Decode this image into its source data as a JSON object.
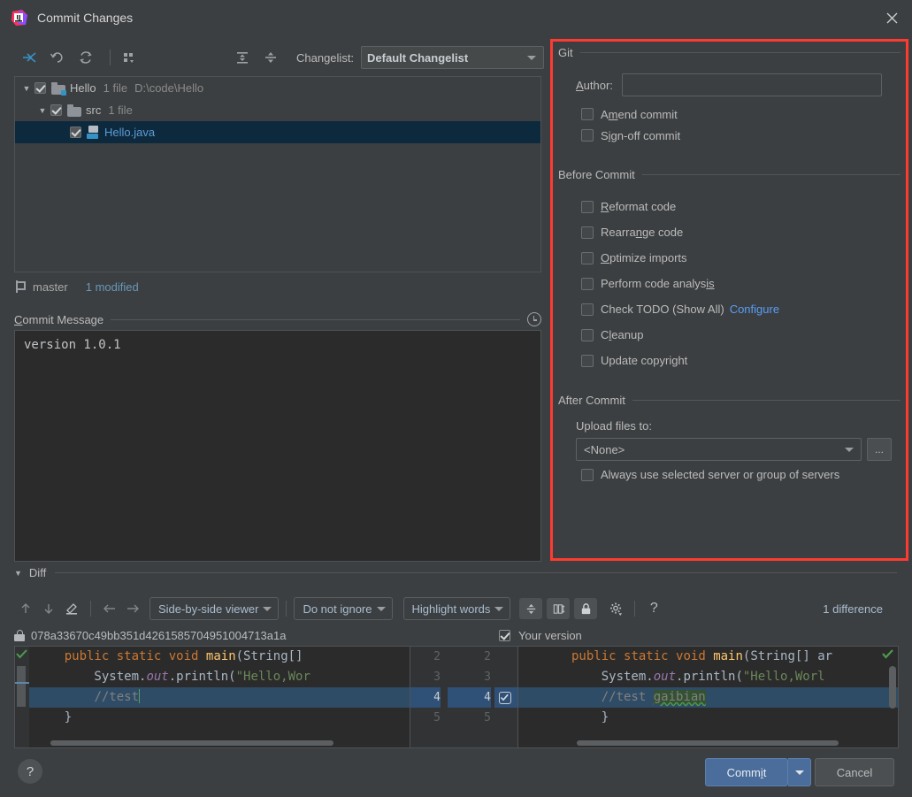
{
  "window": {
    "title": "Commit Changes",
    "logo_icon": "intellij-idea-logo",
    "close_icon": "close-icon"
  },
  "toolbar": {
    "icons": [
      {
        "name": "show-diff-icon",
        "glyph": "arrow-collapse"
      },
      {
        "name": "revert-icon",
        "glyph": "undo"
      },
      {
        "name": "refresh-icon",
        "glyph": "refresh"
      },
      {
        "name": "group-by-icon",
        "glyph": "group"
      },
      {
        "name": "expand-all-icon",
        "glyph": "expand"
      },
      {
        "name": "collapse-all-icon",
        "glyph": "collapse"
      }
    ],
    "changelist_label": "Changelist:",
    "changelist_value": "Default Changelist"
  },
  "tree": {
    "nodes": [
      {
        "name": "Hello",
        "meta": "1 file",
        "path": "D:\\code\\Hello",
        "checked": true,
        "depth": 0,
        "expanded": true,
        "type": "module"
      },
      {
        "name": "src",
        "meta": "1 file",
        "path": "",
        "checked": true,
        "depth": 1,
        "expanded": true,
        "type": "folder"
      },
      {
        "name": "Hello.java",
        "meta": "",
        "path": "",
        "checked": true,
        "depth": 2,
        "expanded": null,
        "type": "java",
        "selected": true
      }
    ]
  },
  "branch": {
    "icon": "git-branch-icon",
    "name": "master",
    "modified": "1 modified"
  },
  "commit_message": {
    "section_title": "Commit Message",
    "section_mnemonic": "C",
    "history_icon": "clock-history-icon",
    "value": "version 1.0.1"
  },
  "options": {
    "git": {
      "title": "Git",
      "author_label": "Author:",
      "author_mnemonic": "A",
      "author_value": "",
      "checkboxes": [
        {
          "label_before": "A",
          "mnemonic": "m",
          "label_after": "end commit",
          "full": "Amend commit",
          "checked": false,
          "name": "amend-commit"
        },
        {
          "label_before": "S",
          "mnemonic": "ig",
          "label_after": "n-off commit",
          "full": "Sign-off commit",
          "checked": false,
          "name": "sign-off-commit"
        }
      ]
    },
    "before_commit": {
      "title": "Before Commit",
      "checkboxes": [
        {
          "label_before": "",
          "mnemonic": "R",
          "label_after": "eformat code",
          "full": "Reformat code",
          "checked": false,
          "name": "reformat-code"
        },
        {
          "label_before": "Rearra",
          "mnemonic": "n",
          "label_after": "ge code",
          "full": "Rearrange code",
          "checked": false,
          "name": "rearrange-code"
        },
        {
          "label_before": "",
          "mnemonic": "O",
          "label_after": "ptimize imports",
          "full": "Optimize imports",
          "checked": false,
          "name": "optimize-imports"
        },
        {
          "label_before": "Perform code analys",
          "mnemonic": "is",
          "label_after": "",
          "full": "Perform code analysis",
          "checked": false,
          "name": "perform-code-analysis"
        },
        {
          "label_before": "Check TODO (Show All)",
          "mnemonic": "",
          "label_after": "",
          "full": "Check TODO (Show All)",
          "checked": false,
          "name": "check-todo",
          "link": "Configure"
        },
        {
          "label_before": "C",
          "mnemonic": "l",
          "label_after": "eanup",
          "full": "Cleanup",
          "checked": false,
          "name": "cleanup"
        },
        {
          "label_before": "Update copyright",
          "mnemonic": "",
          "label_after": "",
          "full": "Update copyright",
          "checked": false,
          "name": "update-copyright"
        }
      ]
    },
    "after_commit": {
      "title": "After Commit",
      "upload_label": "Upload files to:",
      "upload_value": "<None>",
      "browse_label": "...",
      "always_use_label": "Always use selected server or group of servers",
      "always_use_checked": false
    },
    "highlight_border_color": "#ff3a30"
  },
  "diff": {
    "section_title": "Diff",
    "toolbar": {
      "prev_diff_icon": "arrow-up-icon",
      "next_diff_icon": "arrow-down-icon",
      "edit_icon": "pencil-icon",
      "accept_left_icon": "arrow-left-icon",
      "accept_right_icon": "arrow-right-icon",
      "viewer_mode": "Side-by-side viewer",
      "ignore_mode": "Do not ignore",
      "highlight_mode": "Highlight words",
      "collapse_unchanged_icon": "collapse-unchanged-icon",
      "synchronize_icon": "synchronize-scroll-icon",
      "readonly_icon": "lock-icon",
      "settings_icon": "gear-icon",
      "help_icon": "question-icon",
      "difference_count": "1 difference"
    },
    "left_header": {
      "lock_icon": "lock-icon",
      "revision": "078a33670c49bb351d4261585704951004713a1a"
    },
    "right_header": {
      "checked": true,
      "label": "Your version"
    },
    "left_lines": [
      {
        "num": "2",
        "tokens": [
          {
            "t": "    ",
            "c": "plain"
          },
          {
            "t": "public ",
            "c": "kw"
          },
          {
            "t": "static ",
            "c": "kw"
          },
          {
            "t": "void ",
            "c": "kw"
          },
          {
            "t": "main",
            "c": "mname"
          },
          {
            "t": "(String[]",
            "c": "typ"
          }
        ],
        "highlight": false
      },
      {
        "num": "3",
        "tokens": [
          {
            "t": "        System.",
            "c": "typ"
          },
          {
            "t": "out",
            "c": "fld"
          },
          {
            "t": ".println(",
            "c": "typ"
          },
          {
            "t": "\"Hello,Wor",
            "c": "str"
          }
        ],
        "highlight": false
      },
      {
        "num": "4",
        "tokens": [
          {
            "t": "        ",
            "c": "plain"
          },
          {
            "t": "//test",
            "c": "cmt"
          }
        ],
        "highlight": true
      },
      {
        "num": "5",
        "tokens": [
          {
            "t": "    }",
            "c": "typ"
          }
        ],
        "highlight": false
      }
    ],
    "right_lines": [
      {
        "num": "2",
        "tokens": [
          {
            "t": "    ",
            "c": "plain"
          },
          {
            "t": "public ",
            "c": "kw"
          },
          {
            "t": "static ",
            "c": "kw"
          },
          {
            "t": "void ",
            "c": "kw"
          },
          {
            "t": "main",
            "c": "mname"
          },
          {
            "t": "(String[] ar",
            "c": "typ"
          }
        ],
        "highlight": false,
        "check": false
      },
      {
        "num": "3",
        "tokens": [
          {
            "t": "        System.",
            "c": "typ"
          },
          {
            "t": "out",
            "c": "fld"
          },
          {
            "t": ".println(",
            "c": "typ"
          },
          {
            "t": "\"Hello,Worl",
            "c": "str"
          }
        ],
        "highlight": false,
        "check": false
      },
      {
        "num": "4",
        "tokens": [
          {
            "t": "        ",
            "c": "plain"
          },
          {
            "t": "//test ",
            "c": "cmt"
          },
          {
            "t": "gaibian",
            "c": "cmt added"
          }
        ],
        "highlight": true,
        "check": true
      },
      {
        "num": "5",
        "tokens": [
          {
            "t": "    }",
            "c": "typ"
          }
        ],
        "highlight": false,
        "check": false
      }
    ],
    "accept_marker_icon": "accept-change-icon"
  },
  "footer": {
    "help_label": "?",
    "commit_label_before": "Comm",
    "commit_mnemonic": "i",
    "commit_label_after": "t",
    "commit_full": "Commit",
    "cancel_label": "Cancel",
    "commit_dropdown_icon": "chevron-down-icon"
  }
}
